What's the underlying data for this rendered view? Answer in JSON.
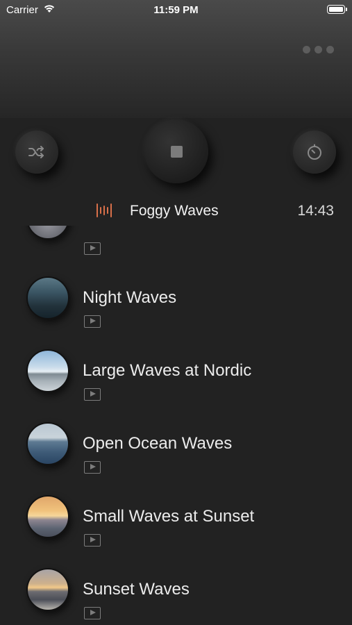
{
  "status_bar": {
    "carrier": "Carrier",
    "time": "11:59 PM"
  },
  "header": {
    "more_icon": "ellipsis-icon"
  },
  "controls": {
    "shuffle_icon": "shuffle-icon",
    "stop_icon": "stop-icon",
    "timer_icon": "timer-icon"
  },
  "now_playing": {
    "title": "Foggy Waves",
    "time": "14:43",
    "icon": "equalizer-icon",
    "accent": "#d9704a"
  },
  "tracks": [
    {
      "title": "",
      "thumb": "dusk"
    },
    {
      "title": "Night Waves",
      "thumb": "night"
    },
    {
      "title": "Large Waves at Nordic",
      "thumb": "nordic"
    },
    {
      "title": "Open Ocean Waves",
      "thumb": "ocean"
    },
    {
      "title": "Small Waves at Sunset",
      "thumb": "sunset1"
    },
    {
      "title": "Sunset Waves",
      "thumb": "sunset2"
    }
  ]
}
